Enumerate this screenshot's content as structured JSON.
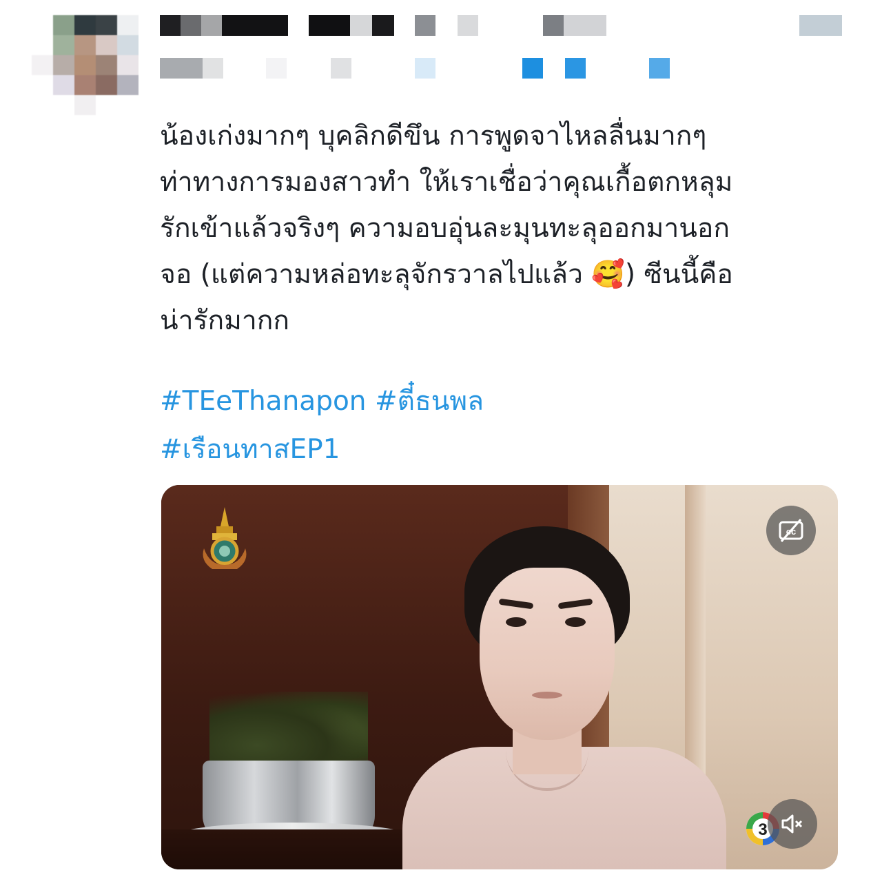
{
  "tweet": {
    "text_lines": [
      "น้องเก่งมากๆ บุคลิกดีขึน การพูดจาไหลลื่นมากๆ",
      "ท่าทางการมองสาวทำ ให้เราเชื่อว่าคุณเกื้อตกหลุม",
      "รักเข้าแล้วจริงๆ ความอบอุ่นละมุนทะลุออกมานอก",
      "จอ (แต่ความหล่อทะลุจักรวาลไปแล้ว 🥰) ซีนนี้คือ",
      "น่ารักมากก"
    ],
    "hashtags": {
      "line1": [
        "#TEeThanapon",
        "#ตี๋ธนพล"
      ],
      "line2": [
        "#เรือนทาสEP1"
      ]
    }
  },
  "video": {
    "cc_icon": "closed-captions-off-icon",
    "mute_icon": "speaker-muted-icon",
    "logo_left": "royal-emblem-logo",
    "logo_right": "channel-3-logo"
  },
  "colors": {
    "text": "#1d2127",
    "hashtag": "#2795e0",
    "overlay": "#555555"
  }
}
